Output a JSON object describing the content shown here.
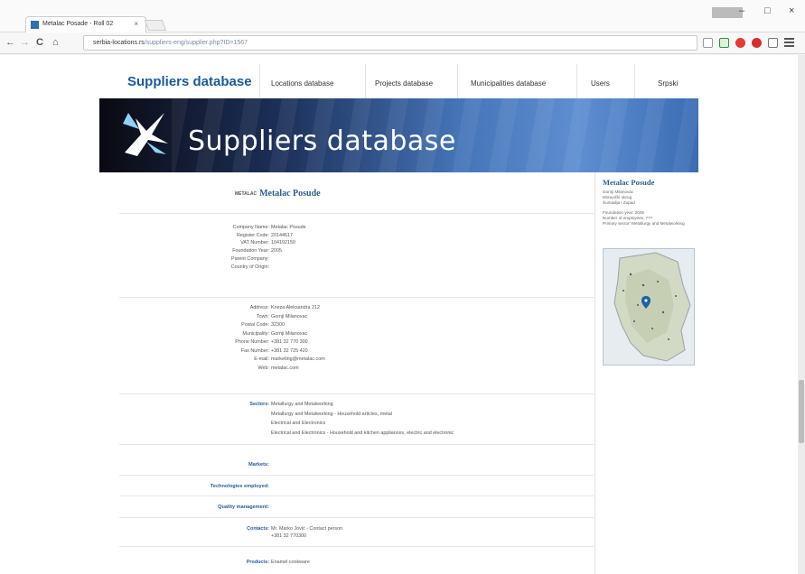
{
  "browser": {
    "tab_title": "Metalac Posade - Roll 02",
    "tab_close": "×",
    "url_domain": "serbia-locations.rs",
    "url_path": "/suppliers-eng/supplier.php?ID=1567",
    "nav_back": "←",
    "nav_forward": "→",
    "nav_reload": "C",
    "nav_home": "⌂",
    "window_minimize": "–",
    "window_maximize": "□",
    "window_close": "×"
  },
  "topnav": {
    "main": "Suppliers database",
    "items": [
      "Locations database",
      "Projects database",
      "Municipalities database",
      "Users",
      "Srpski"
    ]
  },
  "banner": {
    "title": "Suppliers database"
  },
  "company": {
    "prefix": "METALAC",
    "name": "Metalac Posude"
  },
  "details_1": [
    {
      "label": "Company Name:",
      "value": "Metalac Posude"
    },
    {
      "label": "Register Code:",
      "value": "20144617"
    },
    {
      "label": "VAT Number:",
      "value": "104192150"
    },
    {
      "label": "Foundation Year:",
      "value": "2005"
    },
    {
      "label": "Parent Company:",
      "value": ""
    },
    {
      "label": "Country of Origin:",
      "value": ""
    }
  ],
  "details_2": [
    {
      "label": "Address:",
      "value": "Kneza Aleksandra 212"
    },
    {
      "label": "Town:",
      "value": "Gornji Milanovac"
    },
    {
      "label": "Postal Code:",
      "value": "32300"
    },
    {
      "label": "Municipality:",
      "value": "Gornji Milanovac"
    },
    {
      "label": "Phone Number:",
      "value": "+381 32 770 300"
    },
    {
      "label": "Fax Number:",
      "value": "+381 32 725 420"
    },
    {
      "label": "E-mail:",
      "value": "marketing@metalac.com"
    },
    {
      "label": "Web:",
      "value": "metalac.com"
    }
  ],
  "sectors": {
    "label": "Sectors:",
    "values": [
      "Metallurgy and Metalworking",
      "Metallurgy and Metalworking - Household articles, metal",
      "Electrical and Electronics",
      "Electrical and Electronics - Household and kitchen appliances, electric and electronic"
    ]
  },
  "sections": {
    "markets": "Markets:",
    "technologies": "Technologies employed:",
    "quality": "Quality management:",
    "contacts_label": "Contacts:",
    "contacts_line1": "Mr. Marko Jović - Contact person",
    "contacts_line2": "+381 32 770300",
    "products_label": "Products:",
    "products_value": "Enamel cookware"
  },
  "sidebar": {
    "title": "Metalac Posude",
    "lines": [
      "Gornji Milanovac",
      "Moravički okrug",
      "Šumadija i Zapad"
    ],
    "lines2": [
      "Foundation year: 2005",
      "Number of employees: 7??",
      "Primary sector: Metallurgy and Metalworking"
    ]
  }
}
